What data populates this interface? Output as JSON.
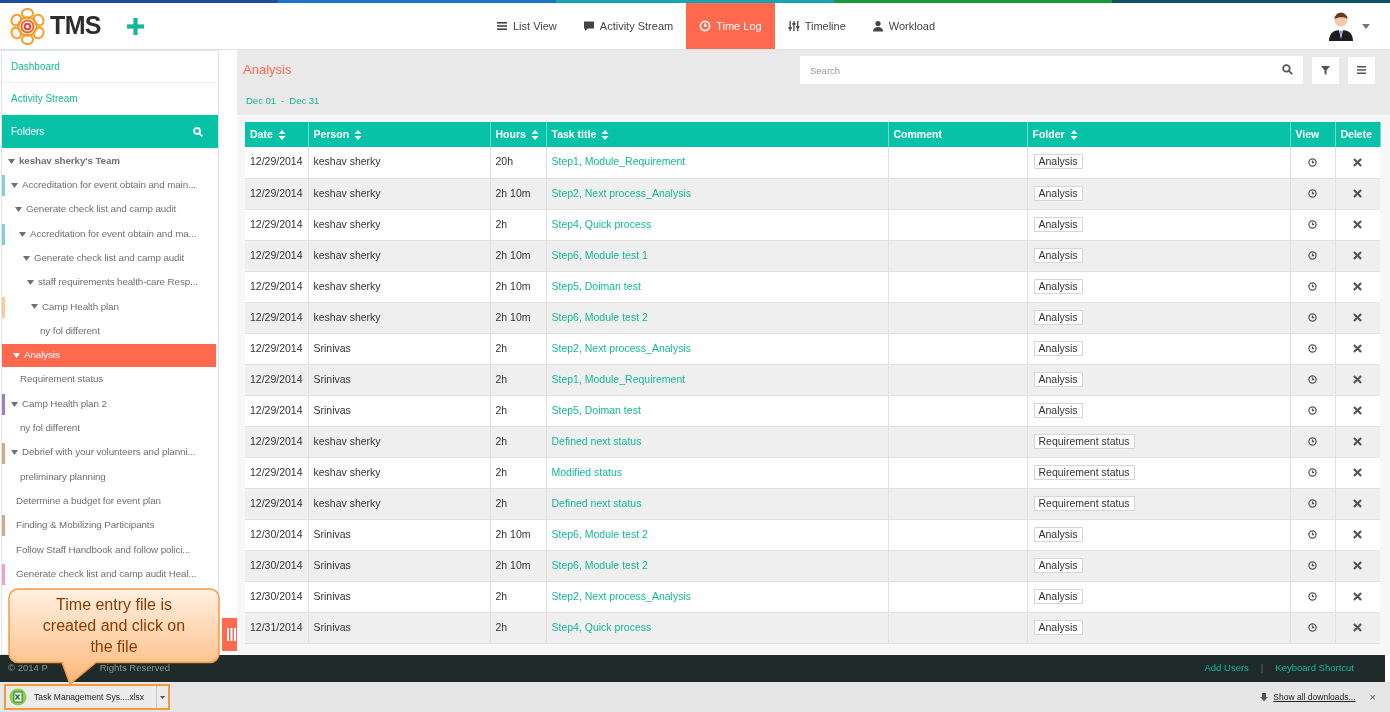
{
  "header": {
    "logo_text": "TMS",
    "nav": [
      {
        "label": "List View",
        "selected": false
      },
      {
        "label": "Activity Stream",
        "selected": false
      },
      {
        "label": "Time Log",
        "selected": true
      },
      {
        "label": "Timeline",
        "selected": false
      },
      {
        "label": "Workload",
        "selected": false
      }
    ]
  },
  "sidebar": {
    "links": [
      "Dashboard",
      "Activity Stream"
    ],
    "folders_title": "Folders",
    "tree": [
      {
        "label": "keshav sherky's Team",
        "expanded": true,
        "selected": false,
        "children": [
          {
            "label": "Accreditation for event obtain and main...",
            "color": "#7fd0d6",
            "expanded": true,
            "selected": false,
            "children": [
              {
                "label": "Generate check list and camp audit",
                "expanded": true,
                "selected": false,
                "children": [
                  {
                    "label": "Accreditation for event obtain and ma...",
                    "color": "#7fd0d6",
                    "expanded": true,
                    "selected": false,
                    "children": [
                      {
                        "label": "Generate check list and camp audit",
                        "expanded": true,
                        "selected": false,
                        "children": [
                          {
                            "label": "staff requirements health-care Resp...",
                            "expanded": true,
                            "selected": false,
                            "children": [
                              {
                                "label": "Camp Health plan",
                                "color": "#ffc891",
                                "expanded": true,
                                "selected": false,
                                "children": [
                                  {
                                    "label": "ny fol different",
                                    "expanded": false,
                                    "selected": false
                                  }
                                ]
                              }
                            ]
                          }
                        ]
                      }
                    ]
                  }
                ]
              }
            ]
          },
          {
            "label": "Analysis",
            "expanded": true,
            "selected": true,
            "children": [
              {
                "label": "Requirement status",
                "expanded": false,
                "selected": false
              }
            ]
          },
          {
            "label": "Camp Health plan 2",
            "color": "#a07bd0",
            "expanded": true,
            "selected": false,
            "children": [
              {
                "label": "ny fol different",
                "expanded": false,
                "selected": false
              }
            ]
          },
          {
            "label": "Debrief with your volunteers and planni...",
            "color": "#d4a880",
            "expanded": true,
            "selected": false,
            "children": [
              {
                "label": "preliminary planning",
                "expanded": false,
                "selected": false
              }
            ]
          },
          {
            "label": "Determine a budget for event plan",
            "expanded": false,
            "selected": false
          },
          {
            "label": "Finding & Mobilizing Participants",
            "color": "#d4a880",
            "expanded": false,
            "selected": false
          },
          {
            "label": "Follow Staff Handbook and follow polici...",
            "expanded": false,
            "selected": false
          },
          {
            "label": "Generate check list and camp audit Heal...",
            "color": "#f0a0d0",
            "expanded": false,
            "selected": false
          }
        ]
      }
    ]
  },
  "main": {
    "title": "Analysis",
    "search": {
      "placeholder": "Search"
    },
    "date_from": "Dec 01",
    "date_sep": "-",
    "date_to": "Dec 31",
    "table": {
      "columns": [
        {
          "label": "Date",
          "sortable": true
        },
        {
          "label": "Person",
          "sortable": true
        },
        {
          "label": "Hours",
          "sortable": true
        },
        {
          "label": "Task title",
          "sortable": true
        },
        {
          "label": "Comment",
          "sortable": false
        },
        {
          "label": "Folder",
          "sortable": true
        },
        {
          "label": "View",
          "sortable": false
        },
        {
          "label": "Delete",
          "sortable": false
        }
      ],
      "rows": [
        {
          "date": "12/29/2014",
          "person": "keshav sherky",
          "hours": "20h",
          "task": "Step1, Module_Requirement",
          "folder": "Analysis"
        },
        {
          "date": "12/29/2014",
          "person": "keshav sherky",
          "hours": "2h 10m",
          "task": "Step2, Next process_Analysis",
          "folder": "Analysis"
        },
        {
          "date": "12/29/2014",
          "person": "keshav sherky",
          "hours": "2h",
          "task": "Step4, Quick process",
          "folder": "Analysis"
        },
        {
          "date": "12/29/2014",
          "person": "keshav sherky",
          "hours": "2h 10m",
          "task": "Step6, Module test 1",
          "folder": "Analysis"
        },
        {
          "date": "12/29/2014",
          "person": "keshav sherky",
          "hours": "2h 10m",
          "task": "Step5, Doiman test",
          "folder": "Analysis"
        },
        {
          "date": "12/29/2014",
          "person": "keshav sherky",
          "hours": "2h 10m",
          "task": "Step6, Module test 2",
          "folder": "Analysis"
        },
        {
          "date": "12/29/2014",
          "person": "Srinivas",
          "hours": "2h",
          "task": "Step2, Next process_Analysis",
          "folder": "Analysis"
        },
        {
          "date": "12/29/2014",
          "person": "Srinivas",
          "hours": "2h",
          "task": "Step1, Module_Requirement",
          "folder": "Analysis"
        },
        {
          "date": "12/29/2014",
          "person": "Srinivas",
          "hours": "2h",
          "task": "Step5, Doiman test",
          "folder": "Analysis"
        },
        {
          "date": "12/29/2014",
          "person": "keshav sherky",
          "hours": "2h",
          "task": "Defined next status",
          "folder": "Requirement status"
        },
        {
          "date": "12/29/2014",
          "person": "keshav sherky",
          "hours": "2h",
          "task": "Modified status",
          "folder": "Requirement status"
        },
        {
          "date": "12/29/2014",
          "person": "keshav sherky",
          "hours": "2h",
          "task": "Defined next status",
          "folder": "Requirement status"
        },
        {
          "date": "12/30/2014",
          "person": "Srinivas",
          "hours": "2h 10m",
          "task": "Step6, Module test 2",
          "folder": "Analysis"
        },
        {
          "date": "12/30/2014",
          "person": "Srinivas",
          "hours": "2h 10m",
          "task": "Step6, Module test 2",
          "folder": "Analysis"
        },
        {
          "date": "12/30/2014",
          "person": "Srinivas",
          "hours": "2h",
          "task": "Step2, Next process_Analysis",
          "folder": "Analysis"
        },
        {
          "date": "12/31/2014",
          "person": "Srinivas",
          "hours": "2h",
          "task": "Step4, Quick process",
          "folder": "Analysis"
        }
      ]
    }
  },
  "footer": {
    "copyright_start": "© 2014 P",
    "copyright_end": "Rights Reserved",
    "links": [
      "Add Users",
      "Keyboard Shortcut"
    ],
    "separator": "|"
  },
  "downloads_bar": {
    "file": "Task Management Sys....xlsx",
    "show_all": "Show all downloads...",
    "close": "×"
  },
  "callout": {
    "text": "Time entry file is created and click on the file"
  }
}
